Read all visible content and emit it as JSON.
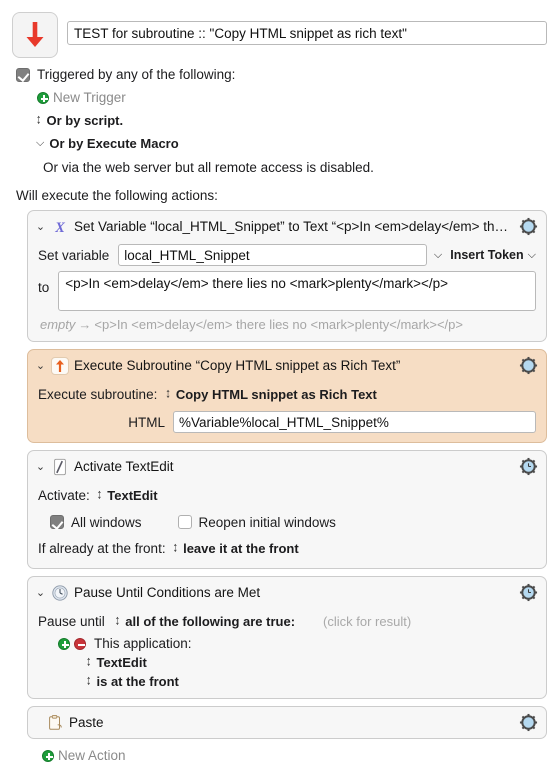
{
  "window": {
    "macro_icon": "red-down-arrow-icon",
    "macro_name": "TEST for subroutine :: \"Copy HTML snippet as rich text\""
  },
  "triggers": {
    "checkbox_checked": true,
    "label": "Triggered by any of the following:",
    "new_trigger_label": "New Trigger",
    "or_by_script": "Or by script.",
    "or_by_execute_macro": "Or by Execute Macro",
    "web_server_note": "Or via the web server but all remote access is disabled."
  },
  "actions_header": "Will execute the following actions:",
  "actions": [
    {
      "id": "set-variable",
      "icon": "script-x-icon",
      "title": "Set Variable “local_HTML_Snippet” to Text “<p>In <em>delay</em> th…",
      "disclosure": "⌄",
      "gear": "gear-icon",
      "set_variable_label": "Set variable",
      "variable_name": "local_HTML_Snippet",
      "insert_token_label": "Insert Token",
      "to_label": "to",
      "value": "<p>In <em>delay</em> there lies no <mark>plenty</mark></p>",
      "preview_from": "empty",
      "preview_arrow": "→",
      "preview_to": "<p>In <em>delay</em> there lies no <mark>plenty</mark></p>"
    },
    {
      "id": "execute-subroutine",
      "icon": "orange-up-arrow-icon",
      "title": "Execute Subroutine “Copy HTML snippet as Rich Text”",
      "disclosure": "⌄",
      "gear": "gear-icon",
      "execute_label": "Execute subroutine:",
      "subroutine_name": "Copy HTML snippet as Rich Text",
      "html_label": "HTML",
      "html_value": "%Variable%local_HTML_Snippet%"
    },
    {
      "id": "activate-textedit",
      "icon": "textedit-icon",
      "title": "Activate TextEdit",
      "disclosure": "⌄",
      "gear": "gear-clock-icon",
      "activate_label": "Activate:",
      "app_name": "TextEdit",
      "all_windows_label": "All windows",
      "all_windows_checked": true,
      "reopen_label": "Reopen initial windows",
      "reopen_checked": false,
      "front_label": "If already at the front:",
      "front_value": "leave it at the front"
    },
    {
      "id": "pause-until",
      "icon": "clock-icon",
      "title": "Pause Until Conditions are Met",
      "disclosure": "⌄",
      "gear": "gear-clock-icon",
      "pause_until_label": "Pause until",
      "pause_condition": "all of the following are true:",
      "click_for_result": "(click for result)",
      "condition_label": "This application:",
      "condition_app": "TextEdit",
      "condition_state": "is at the front"
    },
    {
      "id": "paste",
      "icon": "clipboard-paste-icon",
      "title": "Paste",
      "gear": "gear-icon"
    }
  ],
  "new_action_label": "New Action",
  "colors": {
    "accent_red": "#e8392b",
    "accent_orange": "#e8601f",
    "script_purple": "#6f6ad6",
    "peach_bg": "#f6ddc4",
    "action_bg": "#f7f7f7",
    "green": "#1e9e3b",
    "red": "#c9343a",
    "gear_blue": "#b5d9f0",
    "muted": "#a6a6a6"
  }
}
